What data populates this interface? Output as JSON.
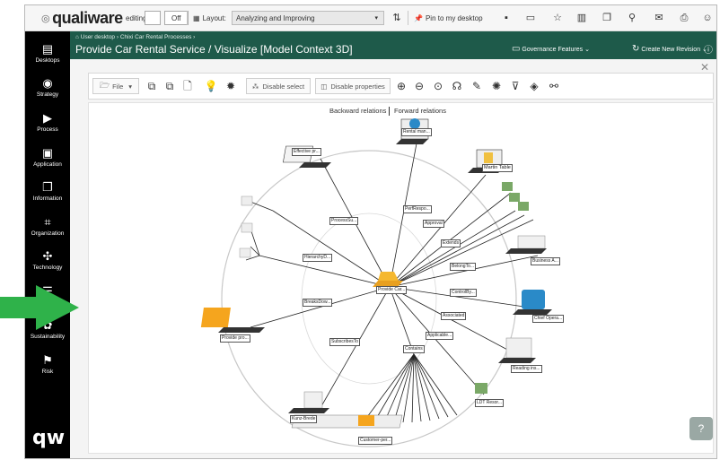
{
  "topbar": {
    "logo": "qualiware",
    "editing_label": "editing:",
    "editing_state": "Off",
    "layout_label": "Layout:",
    "layout_value": "Analyzing and Improving",
    "pin_label": "Pin to my desktop"
  },
  "sidebar": {
    "items": [
      {
        "label": "Desktops",
        "icon": "desktop-icon"
      },
      {
        "label": "Strategy",
        "icon": "target-icon"
      },
      {
        "label": "Process",
        "icon": "process-icon"
      },
      {
        "label": "Application",
        "icon": "application-icon"
      },
      {
        "label": "Information",
        "icon": "document-icon"
      },
      {
        "label": "Organization",
        "icon": "org-chart-icon"
      },
      {
        "label": "Technology",
        "icon": "chip-icon"
      },
      {
        "label": "",
        "icon": "checklist-icon"
      },
      {
        "label": "Sustainability",
        "icon": "leaf-icon"
      },
      {
        "label": "Risk",
        "icon": "flag-icon"
      }
    ],
    "brand": "qw"
  },
  "header": {
    "breadcrumb_1": "User desktop",
    "breadcrumb_2": "Chixi Car Rental Processes",
    "title": "Provide Car Rental Service / Visualize [Model Context 3D]",
    "governance": "Governance Features",
    "create_revision": "Create New Revision"
  },
  "toolbar": {
    "file": "File",
    "disable_select": "Disable select",
    "disable_properties": "Disable properties"
  },
  "graph": {
    "backward": "Backward relations",
    "forward": "Forward relations",
    "center": "Provide Car...",
    "nodes": {
      "rental": "Rental man...",
      "effective": "Effective pr...",
      "martin": "Martin Table",
      "business": "Business A...",
      "chief": "Chief Opera...",
      "reading": "Reading ins...",
      "provide_pro": "Provide pro...",
      "kunz": "Kunz-Brede",
      "ldt": "LDT Resor...",
      "cust": "Customer-per..."
    },
    "relations": {
      "processu": "ProcessSu...",
      "hierarchy": "HierarchyD...",
      "breaksdown": "BreaksDow...",
      "subscribes": "SubscribesTo",
      "contains": "Contains",
      "performs": "PerfRespo...",
      "approval": "Approval",
      "extends": "Extends",
      "belongs": "BelongTo...",
      "controls": "ControlBy...",
      "associated": "Associated",
      "applicable": "Applicable..."
    }
  }
}
